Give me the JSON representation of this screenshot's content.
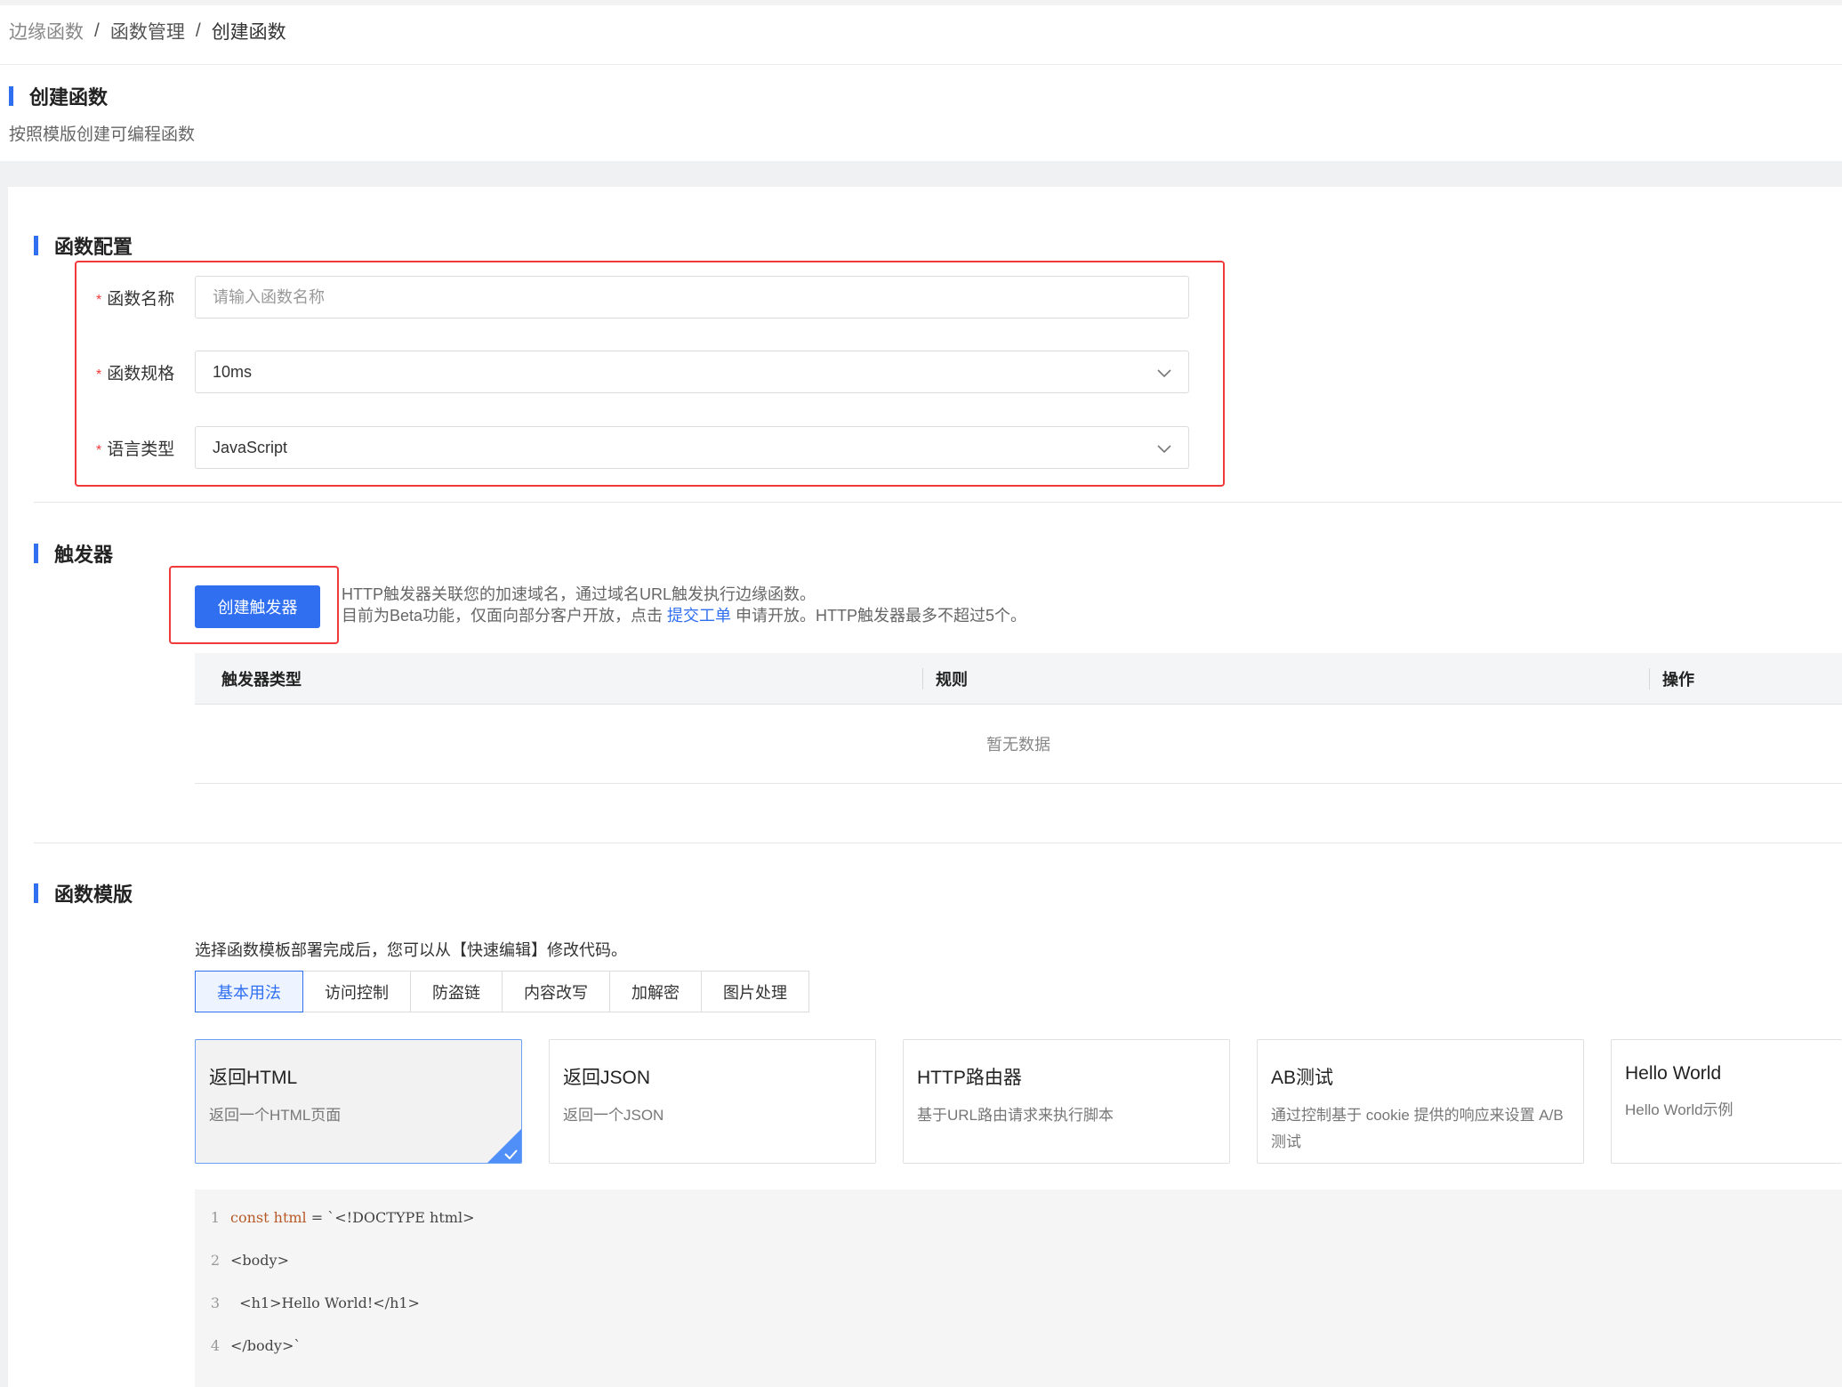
{
  "breadcrumb": {
    "items": [
      "边缘函数",
      "函数管理",
      "创建函数"
    ],
    "separator": "/"
  },
  "page": {
    "title": "创建函数",
    "subtitle": "按照模版创建可编程函数"
  },
  "config": {
    "section_title": "函数配置",
    "name_label": "函数名称",
    "name_placeholder": "请输入函数名称",
    "spec_label": "函数规格",
    "spec_value": "10ms",
    "lang_label": "语言类型",
    "lang_value": "JavaScript",
    "required_mark": "*"
  },
  "trigger": {
    "section_title": "触发器",
    "create_button": "创建触发器",
    "desc_line1": "HTTP触发器关联您的加速域名，通过域名URL触发执行边缘函数。",
    "desc_line2_prefix": "目前为Beta功能，仅面向部分客户开放，点击 ",
    "desc_link": "提交工单",
    "desc_line2_suffix": " 申请开放。HTTP触发器最多不超过5个。",
    "table": {
      "columns": [
        "触发器类型",
        "规则",
        "操作"
      ],
      "empty_text": "暂无数据"
    }
  },
  "templates": {
    "section_title": "函数模版",
    "hint": "选择函数模板部署完成后，您可以从【快速编辑】修改代码。",
    "tabs": [
      "基本用法",
      "访问控制",
      "防盗链",
      "内容改写",
      "加解密",
      "图片处理"
    ],
    "active_tab": "基本用法",
    "cards": [
      {
        "title": "返回HTML",
        "desc": "返回一个HTML页面",
        "selected": true
      },
      {
        "title": "返回JSON",
        "desc": "返回一个JSON",
        "selected": false
      },
      {
        "title": "HTTP路由器",
        "desc": "基于URL路由请求来执行脚本",
        "selected": false
      },
      {
        "title": "AB测试",
        "desc": "通过控制基于 cookie 提供的响应来设置 A/B 测试",
        "selected": false
      },
      {
        "title": "Hello World",
        "desc": "Hello World示例",
        "selected": false
      }
    ]
  },
  "code": {
    "lines": [
      {
        "no": "1",
        "kw": "const",
        "var": "html",
        "rest": " = `<!DOCTYPE html>"
      },
      {
        "no": "2",
        "kw": "",
        "var": "",
        "rest": "<body>"
      },
      {
        "no": "3",
        "kw": "",
        "var": "",
        "rest": "  <h1>Hello World!</h1>"
      },
      {
        "no": "4",
        "kw": "",
        "var": "",
        "rest": "</body>`"
      }
    ]
  },
  "colors": {
    "accent": "#2f6ff0",
    "highlight_box": "#f03a3a"
  }
}
